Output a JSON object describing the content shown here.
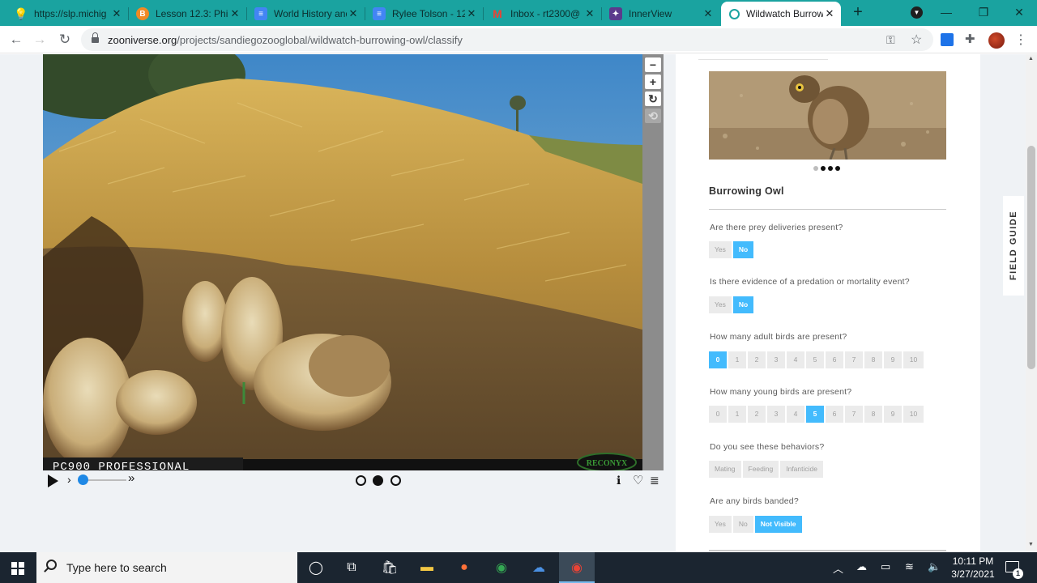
{
  "browser": {
    "tabs": [
      {
        "title": "https://slp.michig",
        "icon": "lightbulb-icon",
        "color": "#f6c026"
      },
      {
        "title": "Lesson 12.3: Philo",
        "icon": "schoology-b-icon",
        "color": "#f08a24"
      },
      {
        "title": "World History and",
        "icon": "google-docs-icon",
        "color": "#4285f4"
      },
      {
        "title": "Rylee Tolson - 12.",
        "icon": "google-docs-icon",
        "color": "#4285f4"
      },
      {
        "title": "Inbox - rt2300@",
        "icon": "gmail-icon",
        "color": "#ea4335"
      },
      {
        "title": "InnerView",
        "icon": "innerview-icon",
        "color": "#5b3a8c"
      },
      {
        "title": "Wildwatch Burrow",
        "icon": "zooniverse-icon",
        "color": "#1aa3a0",
        "active": true
      }
    ],
    "tab_close_glyph": "✕",
    "new_tab_glyph": "+",
    "url_domain": "zooniverse.org",
    "url_path": "/projects/sandiegozooglobal/wildwatch-burrowing-owl/classify",
    "theme_color": "#1aa3a0"
  },
  "viewer": {
    "camera_text": "PC900 PROFESSIONAL",
    "camera_brand": "RECONYX",
    "tools": [
      "−",
      "+",
      "↻",
      "⟲"
    ],
    "controls": {
      "play_glyph": "▶",
      "slow_glyph": "›",
      "fast_glyph": "»",
      "speed_level": 0.0,
      "frames": 3,
      "current_frame": 2,
      "info_glyph": "ℹ",
      "heart_glyph": "♡",
      "collections_glyph": "≣"
    }
  },
  "task": {
    "example_dots": {
      "count": 4,
      "active": 0
    },
    "choice_name": "Burrowing Owl",
    "questions": [
      {
        "q": "Are there prey deliveries present?",
        "answers": [
          "Yes",
          "No"
        ],
        "selected": "No"
      },
      {
        "q": "Is there evidence of a predation or mortality event?",
        "answers": [
          "Yes",
          "No"
        ],
        "selected": "No"
      },
      {
        "q": "How many adult birds are present?",
        "answers": [
          "0",
          "1",
          "2",
          "3",
          "4",
          "5",
          "6",
          "7",
          "8",
          "9",
          "10"
        ],
        "selected": "0"
      },
      {
        "q": "How many young birds are present?",
        "answers": [
          "0",
          "1",
          "2",
          "3",
          "4",
          "5",
          "6",
          "7",
          "8",
          "9",
          "10"
        ],
        "selected": "5"
      },
      {
        "q": "Do you see these behaviors?",
        "answers": [
          "Mating",
          "Feeding",
          "Infanticide"
        ],
        "selected": null
      },
      {
        "q": "Are any birds banded?",
        "answers": [
          "Yes",
          "No",
          "Not Visible"
        ],
        "selected": "Not Visible"
      }
    ],
    "accent_color": "#43bbfd"
  },
  "field_guide_label": "FIELD GUIDE",
  "taskbar": {
    "search_placeholder": "Type here to search",
    "time": "10:11 PM",
    "date": "3/27/2021",
    "notification_count": "1"
  }
}
